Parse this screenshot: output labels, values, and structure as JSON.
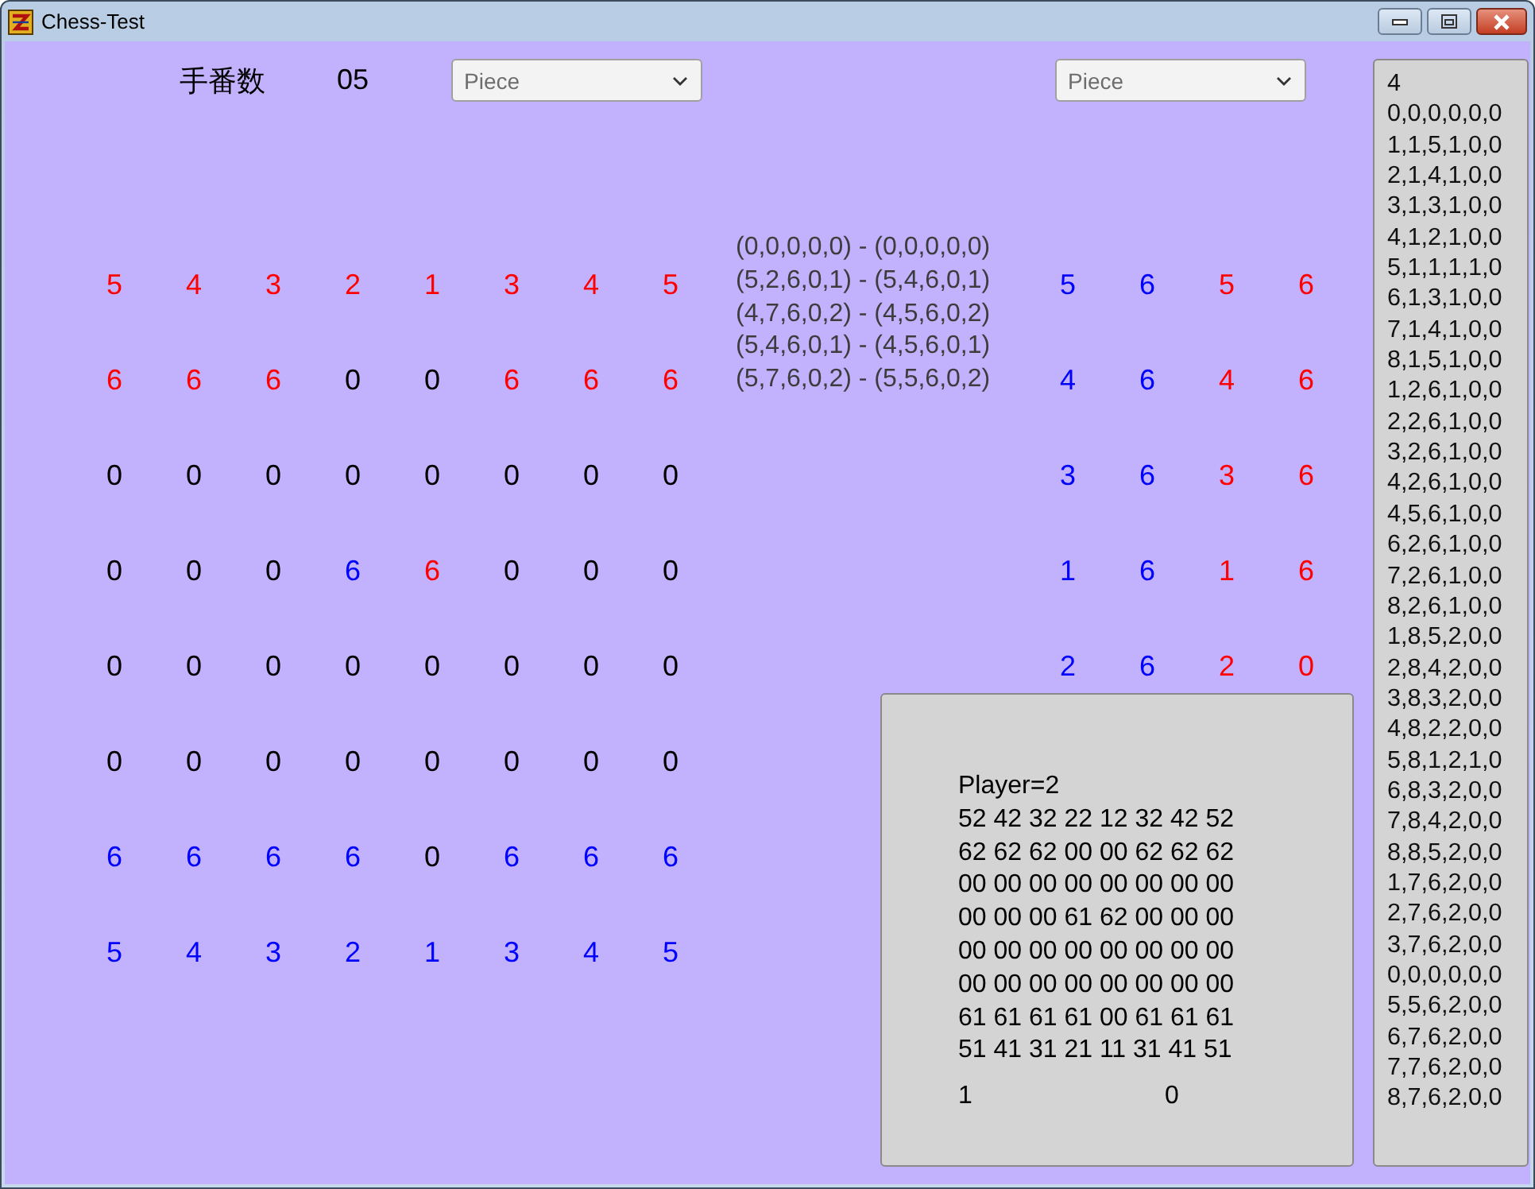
{
  "window": {
    "title": "Chess-Test"
  },
  "turn": {
    "label": "手番数",
    "value": "05"
  },
  "dropdowns": [
    {
      "placeholder": "Piece"
    },
    {
      "placeholder": "Piece"
    }
  ],
  "board": {
    "rows": [
      [
        {
          "value": "5",
          "color": "#ff0000"
        },
        {
          "value": "4",
          "color": "#ff0000"
        },
        {
          "value": "3",
          "color": "#ff0000"
        },
        {
          "value": "2",
          "color": "#ff0000"
        },
        {
          "value": "1",
          "color": "#ff0000"
        },
        {
          "value": "3",
          "color": "#ff0000"
        },
        {
          "value": "4",
          "color": "#ff0000"
        },
        {
          "value": "5",
          "color": "#ff0000"
        }
      ],
      [
        {
          "value": "6",
          "color": "#ff0000"
        },
        {
          "value": "6",
          "color": "#ff0000"
        },
        {
          "value": "6",
          "color": "#ff0000"
        },
        {
          "value": "0",
          "color": "#000000"
        },
        {
          "value": "0",
          "color": "#000000"
        },
        {
          "value": "6",
          "color": "#ff0000"
        },
        {
          "value": "6",
          "color": "#ff0000"
        },
        {
          "value": "6",
          "color": "#ff0000"
        }
      ],
      [
        {
          "value": "0",
          "color": "#000000"
        },
        {
          "value": "0",
          "color": "#000000"
        },
        {
          "value": "0",
          "color": "#000000"
        },
        {
          "value": "0",
          "color": "#000000"
        },
        {
          "value": "0",
          "color": "#000000"
        },
        {
          "value": "0",
          "color": "#000000"
        },
        {
          "value": "0",
          "color": "#000000"
        },
        {
          "value": "0",
          "color": "#000000"
        }
      ],
      [
        {
          "value": "0",
          "color": "#000000"
        },
        {
          "value": "0",
          "color": "#000000"
        },
        {
          "value": "0",
          "color": "#000000"
        },
        {
          "value": "6",
          "color": "#0000ff"
        },
        {
          "value": "6",
          "color": "#ff0000"
        },
        {
          "value": "0",
          "color": "#000000"
        },
        {
          "value": "0",
          "color": "#000000"
        },
        {
          "value": "0",
          "color": "#000000"
        }
      ],
      [
        {
          "value": "0",
          "color": "#000000"
        },
        {
          "value": "0",
          "color": "#000000"
        },
        {
          "value": "0",
          "color": "#000000"
        },
        {
          "value": "0",
          "color": "#000000"
        },
        {
          "value": "0",
          "color": "#000000"
        },
        {
          "value": "0",
          "color": "#000000"
        },
        {
          "value": "0",
          "color": "#000000"
        },
        {
          "value": "0",
          "color": "#000000"
        }
      ],
      [
        {
          "value": "0",
          "color": "#000000"
        },
        {
          "value": "0",
          "color": "#000000"
        },
        {
          "value": "0",
          "color": "#000000"
        },
        {
          "value": "0",
          "color": "#000000"
        },
        {
          "value": "0",
          "color": "#000000"
        },
        {
          "value": "0",
          "color": "#000000"
        },
        {
          "value": "0",
          "color": "#000000"
        },
        {
          "value": "0",
          "color": "#000000"
        }
      ],
      [
        {
          "value": "6",
          "color": "#0000ff"
        },
        {
          "value": "6",
          "color": "#0000ff"
        },
        {
          "value": "6",
          "color": "#0000ff"
        },
        {
          "value": "6",
          "color": "#0000ff"
        },
        {
          "value": "0",
          "color": "#000000"
        },
        {
          "value": "6",
          "color": "#0000ff"
        },
        {
          "value": "6",
          "color": "#0000ff"
        },
        {
          "value": "6",
          "color": "#0000ff"
        }
      ],
      [
        {
          "value": "5",
          "color": "#0000ff"
        },
        {
          "value": "4",
          "color": "#0000ff"
        },
        {
          "value": "3",
          "color": "#0000ff"
        },
        {
          "value": "2",
          "color": "#0000ff"
        },
        {
          "value": "1",
          "color": "#0000ff"
        },
        {
          "value": "3",
          "color": "#0000ff"
        },
        {
          "value": "4",
          "color": "#0000ff"
        },
        {
          "value": "5",
          "color": "#0000ff"
        }
      ]
    ]
  },
  "moves": [
    "(0,0,0,0,0) - (0,0,0,0,0)",
    "(5,2,6,0,1) - (5,4,6,0,1)",
    "(4,7,6,0,2) - (4,5,6,0,2)",
    "(5,4,6,0,1) - (4,5,6,0,1)",
    "(5,7,6,0,2) - (5,5,6,0,2)"
  ],
  "side_grid": {
    "rows": [
      [
        {
          "value": "5",
          "color": "#0000ff"
        },
        {
          "value": "6",
          "color": "#0000ff"
        },
        {
          "value": "5",
          "color": "#ff0000"
        },
        {
          "value": "6",
          "color": "#ff0000"
        }
      ],
      [
        {
          "value": "4",
          "color": "#0000ff"
        },
        {
          "value": "6",
          "color": "#0000ff"
        },
        {
          "value": "4",
          "color": "#ff0000"
        },
        {
          "value": "6",
          "color": "#ff0000"
        }
      ],
      [
        {
          "value": "3",
          "color": "#0000ff"
        },
        {
          "value": "6",
          "color": "#0000ff"
        },
        {
          "value": "3",
          "color": "#ff0000"
        },
        {
          "value": "6",
          "color": "#ff0000"
        }
      ],
      [
        {
          "value": "1",
          "color": "#0000ff"
        },
        {
          "value": "6",
          "color": "#0000ff"
        },
        {
          "value": "1",
          "color": "#ff0000"
        },
        {
          "value": "6",
          "color": "#ff0000"
        }
      ],
      [
        {
          "value": "2",
          "color": "#0000ff"
        },
        {
          "value": "6",
          "color": "#0000ff"
        },
        {
          "value": "2",
          "color": "#ff0000"
        },
        {
          "value": "0",
          "color": "#ff0000"
        }
      ]
    ]
  },
  "state_panel": {
    "lines": [
      "Player=2",
      "52 42 32 22 12 32 42 52",
      "62 62 62 00 00 62 62 62",
      "00 00 00 00 00 00 00 00",
      "00 00 00 61 62 00 00 00",
      "00 00 00 00 00 00 00 00",
      "00 00 00 00 00 00 00 00",
      "61 61 61 61 00 61 61 61",
      "51 41 31 21 11 31 41 51"
    ],
    "footer": [
      "1",
      "0"
    ]
  },
  "log_list": {
    "items": [
      "4",
      "0,0,0,0,0,0",
      "1,1,5,1,0,0",
      "2,1,4,1,0,0",
      "3,1,3,1,0,0",
      "4,1,2,1,0,0",
      "5,1,1,1,1,0",
      "6,1,3,1,0,0",
      "7,1,4,1,0,0",
      "8,1,5,1,0,0",
      "1,2,6,1,0,0",
      "2,2,6,1,0,0",
      "3,2,6,1,0,0",
      "4,2,6,1,0,0",
      "4,5,6,1,0,0",
      "6,2,6,1,0,0",
      "7,2,6,1,0,0",
      "8,2,6,1,0,0",
      "1,8,5,2,0,0",
      "2,8,4,2,0,0",
      "3,8,3,2,0,0",
      "4,8,2,2,0,0",
      "5,8,1,2,1,0",
      "6,8,3,2,0,0",
      "7,8,4,2,0,0",
      "8,8,5,2,0,0",
      "1,7,6,2,0,0",
      "2,7,6,2,0,0",
      "3,7,6,2,0,0",
      "0,0,0,0,0,0",
      "5,5,6,2,0,0",
      "6,7,6,2,0,0",
      "7,7,6,2,0,0",
      "8,7,6,2,0,0"
    ]
  }
}
